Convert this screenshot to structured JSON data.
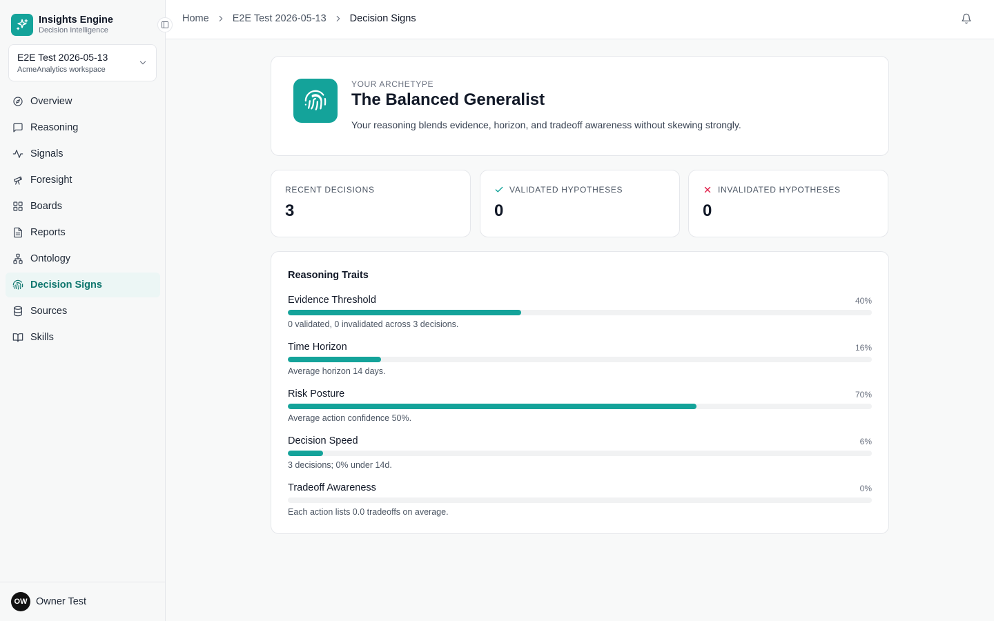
{
  "app": {
    "name": "Insights Engine",
    "subtitle": "Decision Intelligence"
  },
  "workspace": {
    "name": "E2E Test 2026-05-13",
    "subtitle": "AcmeAnalytics workspace"
  },
  "nav": [
    {
      "label": "Overview",
      "icon": "compass-icon"
    },
    {
      "label": "Reasoning",
      "icon": "message-square-icon"
    },
    {
      "label": "Signals",
      "icon": "activity-icon"
    },
    {
      "label": "Foresight",
      "icon": "telescope-icon"
    },
    {
      "label": "Boards",
      "icon": "grid-icon"
    },
    {
      "label": "Reports",
      "icon": "file-text-icon"
    },
    {
      "label": "Ontology",
      "icon": "network-icon"
    },
    {
      "label": "Decision Signs",
      "icon": "fingerprint-icon",
      "active": true
    },
    {
      "label": "Sources",
      "icon": "database-icon"
    },
    {
      "label": "Skills",
      "icon": "book-open-icon"
    }
  ],
  "user": {
    "initials": "OW",
    "name": "Owner Test"
  },
  "breadcrumb": [
    "Home",
    "E2E Test 2026-05-13",
    "Decision Signs"
  ],
  "archetype": {
    "eyebrow": "YOUR ARCHETYPE",
    "title": "The Balanced Generalist",
    "description": "Your reasoning blends evidence, horizon, and tradeoff awareness without skewing strongly."
  },
  "stats": [
    {
      "label": "RECENT DECISIONS",
      "value": "3",
      "icon": ""
    },
    {
      "label": "VALIDATED HYPOTHESES",
      "value": "0",
      "icon": "check-icon",
      "icon_color": "#14a39a"
    },
    {
      "label": "INVALIDATED HYPOTHESES",
      "value": "0",
      "icon": "x-icon",
      "icon_color": "#e11d48"
    }
  ],
  "traits": {
    "title": "Reasoning Traits",
    "items": [
      {
        "name": "Evidence Threshold",
        "percent_label": "40%",
        "value": 0.4,
        "note": "0 validated, 0 invalidated across 3 decisions."
      },
      {
        "name": "Time Horizon",
        "percent_label": "16%",
        "value": 0.16,
        "note": "Average horizon 14 days."
      },
      {
        "name": "Risk Posture",
        "percent_label": "70%",
        "value": 0.7,
        "note": "Average action confidence 50%."
      },
      {
        "name": "Decision Speed",
        "percent_label": "6%",
        "value": 0.06,
        "note": "3 decisions; 0% under 14d."
      },
      {
        "name": "Tradeoff Awareness",
        "percent_label": "0%",
        "value": 0.0,
        "note": "Each action lists 0.0 tradeoffs on average."
      }
    ]
  },
  "colors": {
    "accent": "#14a39a",
    "active_bg": "#ecf6f5",
    "active_text": "#0f766e",
    "danger": "#e11d48"
  }
}
